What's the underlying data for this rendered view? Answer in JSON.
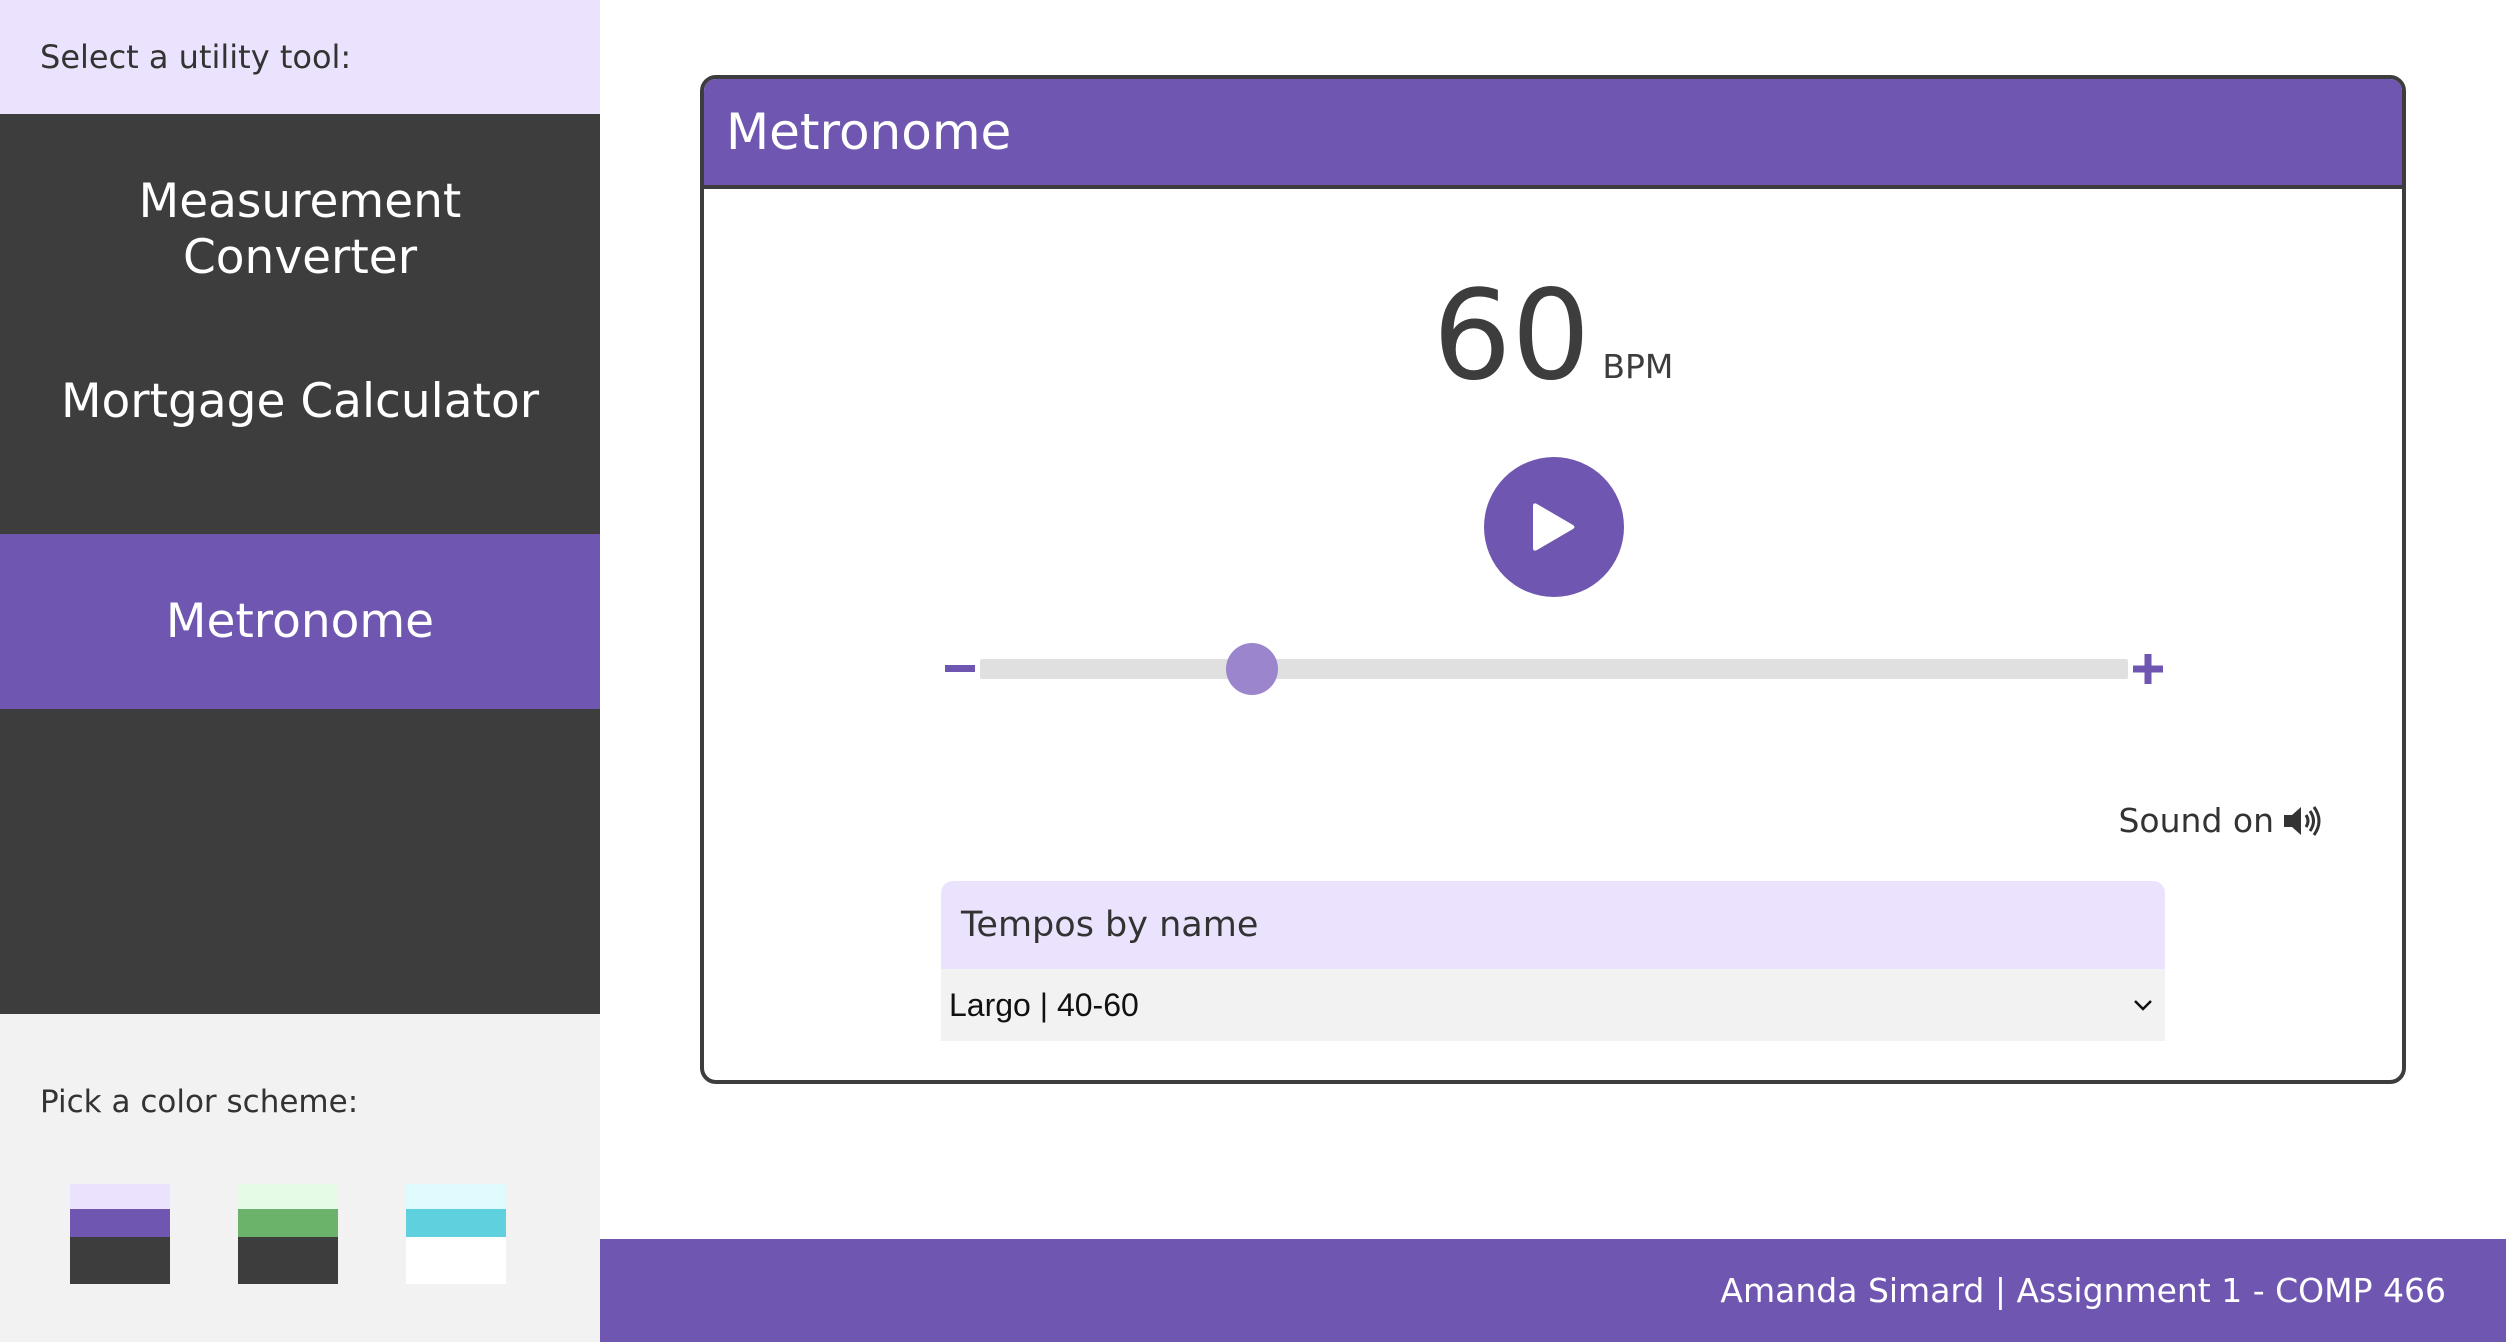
{
  "sidebar": {
    "header": "Select a utility tool:",
    "tools": [
      {
        "label": "Measurement Converter"
      },
      {
        "label": "Mortgage Calculator"
      },
      {
        "label": "Metronome",
        "active": true
      }
    ],
    "scheme_label": "Pick a color scheme:",
    "schemes": [
      {
        "name": "purple",
        "colors": [
          "#ebe3fd",
          "#6f56b0",
          "#3d3d3d"
        ]
      },
      {
        "name": "green",
        "colors": [
          "#e6fbe6",
          "#6bb36b",
          "#3d3d3d"
        ]
      },
      {
        "name": "cyan",
        "colors": [
          "#e0fbfd",
          "#5fd0de",
          "#ffffff"
        ]
      }
    ]
  },
  "card": {
    "title": "Metronome",
    "bpm": "60",
    "bpm_unit": "BPM",
    "slider": {
      "min": 40,
      "max": 220,
      "value": 60
    },
    "sound_label": "Sound on",
    "tempos_label": "Tempos by name",
    "tempos_selected": "Largo | 40-60"
  },
  "footer": {
    "text": "Amanda Simard | Assignment 1 - COMP 466"
  },
  "colors": {
    "accent": "#6f56b0",
    "dark": "#3d3d3d",
    "light_accent": "#ebe3fd"
  }
}
